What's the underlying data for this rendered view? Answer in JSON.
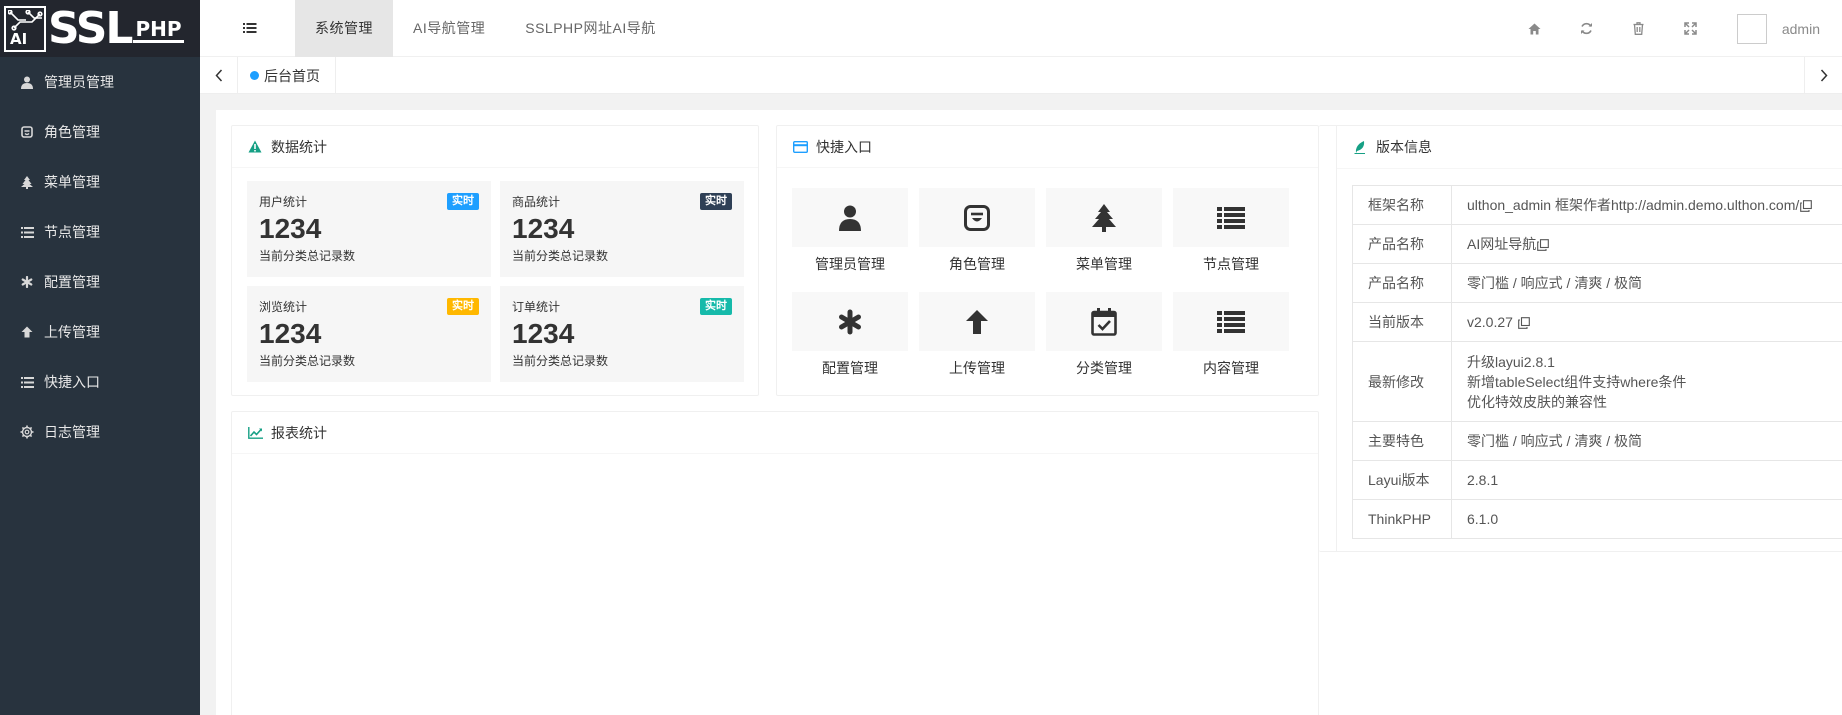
{
  "brand": {
    "logo_ai": "AI",
    "logo_main": "SSL",
    "logo_sub": "PHP"
  },
  "sidebar": {
    "items": [
      {
        "label": "管理员管理",
        "icon": "user-icon"
      },
      {
        "label": "角色管理",
        "icon": "role-icon"
      },
      {
        "label": "菜单管理",
        "icon": "tree-icon"
      },
      {
        "label": "节点管理",
        "icon": "list-icon"
      },
      {
        "label": "配置管理",
        "icon": "asterisk-icon"
      },
      {
        "label": "上传管理",
        "icon": "upload-icon"
      },
      {
        "label": "快捷入口",
        "icon": "list-icon"
      },
      {
        "label": "日志管理",
        "icon": "gear-icon"
      }
    ]
  },
  "header": {
    "tabs": [
      {
        "label": "系统管理",
        "active": true
      },
      {
        "label": "AI导航管理",
        "active": false
      },
      {
        "label": "SSLPHP网址AI导航",
        "active": false
      }
    ],
    "user": "admin"
  },
  "tabbar": {
    "current_tab": "后台首页"
  },
  "stats_card": {
    "title": "数据统计",
    "items": [
      {
        "title": "用户统计",
        "badge": "实时",
        "badge_color": "#1e9fff",
        "value": "1234",
        "sub": "当前分类总记录数"
      },
      {
        "title": "商品统计",
        "badge": "实时",
        "badge_color": "#2f4056",
        "value": "1234",
        "sub": "当前分类总记录数"
      },
      {
        "title": "浏览统计",
        "badge": "实时",
        "badge_color": "#ffb800",
        "value": "1234",
        "sub": "当前分类总记录数"
      },
      {
        "title": "订单统计",
        "badge": "实时",
        "badge_color": "#16baaa",
        "value": "1234",
        "sub": "当前分类总记录数"
      }
    ]
  },
  "quick_card": {
    "title": "快捷入口",
    "items": [
      {
        "label": "管理员管理",
        "icon": "user-icon"
      },
      {
        "label": "角色管理",
        "icon": "role-icon"
      },
      {
        "label": "菜单管理",
        "icon": "tree-icon"
      },
      {
        "label": "节点管理",
        "icon": "list-icon"
      },
      {
        "label": "配置管理",
        "icon": "asterisk-icon"
      },
      {
        "label": "上传管理",
        "icon": "upload-arrow-icon"
      },
      {
        "label": "分类管理",
        "icon": "calendar-check-icon"
      },
      {
        "label": "内容管理",
        "icon": "list-icon"
      }
    ]
  },
  "chart_card": {
    "title": "报表统计"
  },
  "version_card": {
    "title": "版本信息",
    "rows": [
      {
        "key": "框架名称",
        "value": "ulthon_admin 框架作者http://admin.demo.ulthon.com/"
      },
      {
        "key": "产品名称",
        "value": "AI网址导航"
      },
      {
        "key": "产品名称",
        "value": "零门槛 / 响应式 / 清爽 / 极简"
      },
      {
        "key": "当前版本",
        "value": "v2.0.27"
      },
      {
        "key": "最新修改",
        "lines": [
          "升级layui2.8.1",
          "新增tableSelect组件支持where条件",
          "优化特效皮肤的兼容性"
        ]
      },
      {
        "key": "主要特色",
        "value": "零门槛 / 响应式 / 清爽 / 极简"
      },
      {
        "key": "Layui版本",
        "value": "2.8.1"
      },
      {
        "key": "ThinkPHP",
        "value": "6.1.0"
      }
    ]
  },
  "colors": {
    "sidebar_bg": "#28333e",
    "accent": "#1e9fff"
  }
}
